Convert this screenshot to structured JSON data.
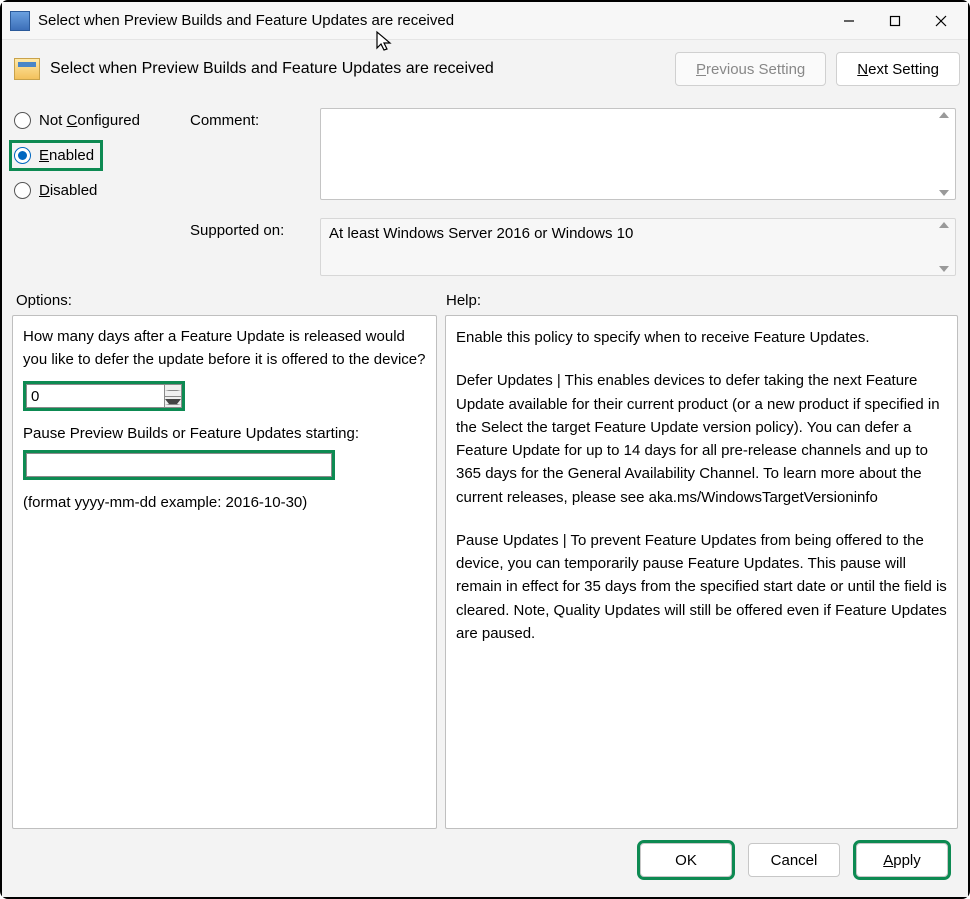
{
  "window": {
    "title": "Select when Preview Builds and Feature Updates are received"
  },
  "heading": "Select when Preview Builds and Feature Updates are received",
  "nav": {
    "previous": "Previous Setting",
    "next": "Next Setting",
    "previous_enabled": false,
    "next_enabled": true
  },
  "state": {
    "radios": {
      "not_configured": "Not Configured",
      "enabled": "Enabled",
      "disabled": "Disabled",
      "selected": "enabled"
    },
    "comment_label": "Comment:",
    "comment_value": "",
    "supported_label": "Supported on:",
    "supported_value": "At least Windows Server 2016 or Windows 10"
  },
  "sections": {
    "options_label": "Options:",
    "help_label": "Help:"
  },
  "options": {
    "defer_question": "How many days after a Feature Update is released would you like to defer the update before it is offered to the device?",
    "defer_value": "0",
    "pause_label": "Pause Preview Builds or Feature Updates starting:",
    "pause_value": "",
    "format_hint": "(format yyyy-mm-dd example: 2016-10-30)"
  },
  "help": {
    "p1": "Enable this policy to specify when to receive Feature Updates.",
    "p2": "Defer Updates | This enables devices to defer taking the next Feature Update available for their current product (or a new product if specified in the Select the target Feature Update version policy). You can defer a Feature Update for up to 14 days for all pre-release channels and up to 365 days for the General Availability Channel. To learn more about the current releases, please see aka.ms/WindowsTargetVersioninfo",
    "p3": "Pause Updates | To prevent Feature Updates from being offered to the device, you can temporarily pause Feature Updates. This pause will remain in effect for 35 days from the specified start date or until the field is cleared. Note, Quality Updates will still be offered even if Feature Updates are paused."
  },
  "footer": {
    "ok": "OK",
    "cancel": "Cancel",
    "apply": "Apply"
  }
}
